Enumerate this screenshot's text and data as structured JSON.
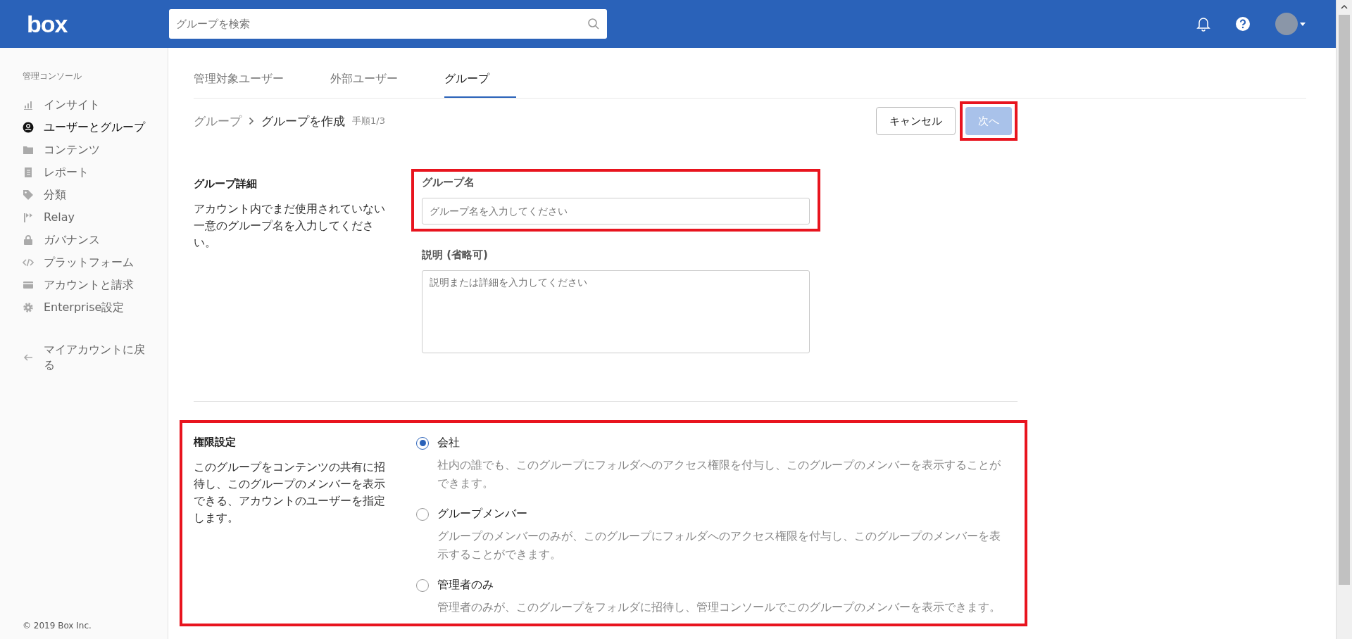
{
  "header": {
    "logo": "box",
    "search": {
      "placeholder": "グループを検索"
    }
  },
  "sidebar": {
    "heading": "管理コンソール",
    "items": [
      {
        "label": "インサイト",
        "selected": false
      },
      {
        "label": "ユーザーとグループ",
        "selected": true
      },
      {
        "label": "コンテンツ",
        "selected": false
      },
      {
        "label": "レポート",
        "selected": false
      },
      {
        "label": "分類",
        "selected": false
      },
      {
        "label": "Relay",
        "selected": false
      },
      {
        "label": "ガバナンス",
        "selected": false
      },
      {
        "label": "プラットフォーム",
        "selected": false
      },
      {
        "label": "アカウントと請求",
        "selected": false
      },
      {
        "label": "Enterprise設定",
        "selected": false
      }
    ],
    "back_link": "マイアカウントに戻る",
    "copyright": "© 2019 Box Inc."
  },
  "tabs": [
    {
      "label": "管理対象ユーザー",
      "selected": false
    },
    {
      "label": "外部ユーザー",
      "selected": false
    },
    {
      "label": "グループ",
      "selected": true
    }
  ],
  "breadcrumb": {
    "parent": "グループ",
    "current": "グループを作成",
    "step": "手順1/3"
  },
  "buttons": {
    "cancel": "キャンセル",
    "next": {
      "label": "次へ",
      "disabled": true,
      "highlighted": true
    }
  },
  "details": {
    "title": "グループ詳細",
    "description": "アカウント内でまだ使用されていない一意のグループ名を入力してください。",
    "fields": [
      {
        "kind": "input",
        "label": "グループ名",
        "placeholder": "グループ名を入力してください",
        "highlighted": true
      },
      {
        "kind": "textarea",
        "label": "説明 (省略可)",
        "placeholder": "説明または詳細を入力してください",
        "highlighted": false
      }
    ]
  },
  "permissions": {
    "title": "権限設定",
    "description": "このグループをコンテンツの共有に招待し、このグループのメンバーを表示できる、アカウントのユーザーを指定します。",
    "highlighted": true,
    "options": [
      {
        "label": "会社",
        "description": "社内の誰でも、このグループにフォルダへのアクセス権限を付与し、このグループのメンバーを表示することができます。",
        "selected": true
      },
      {
        "label": "グループメンバー",
        "description": "グループのメンバーのみが、このグループにフォルダへのアクセス権限を付与し、このグループのメンバーを表示することができます。",
        "selected": false
      },
      {
        "label": "管理者のみ",
        "description": "管理者のみが、このグループをフォルダに招待し、管理コンソールでこのグループのメンバーを表示できます。",
        "selected": false
      }
    ]
  }
}
